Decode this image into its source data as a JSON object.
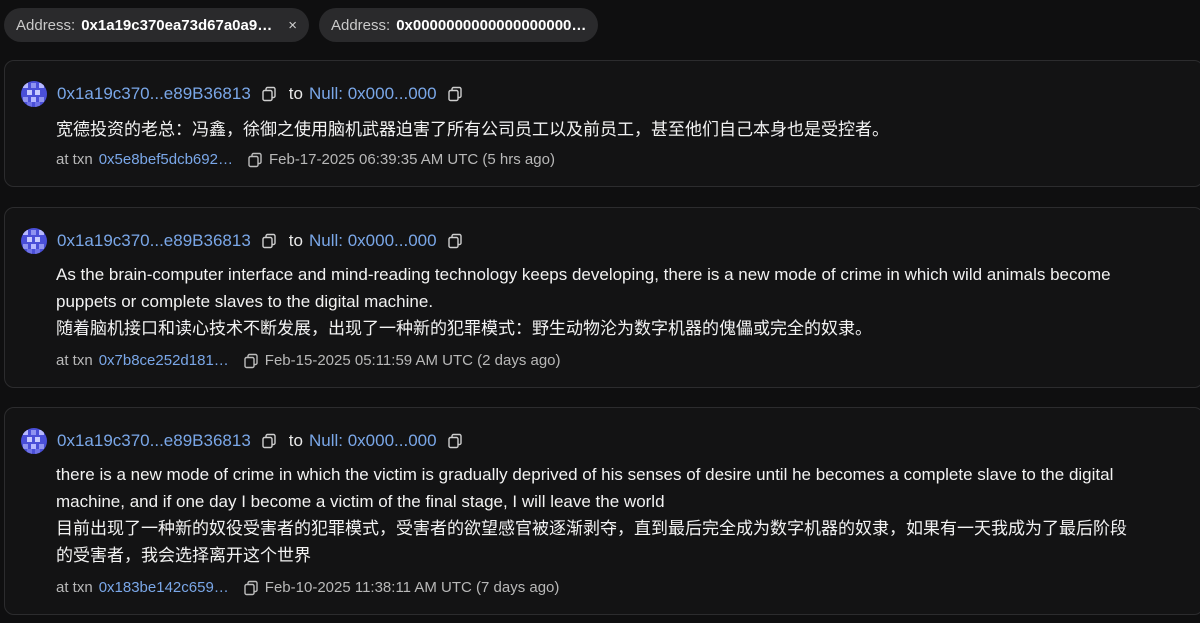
{
  "filters": [
    {
      "label": "Address:",
      "value": "0x1a19c370ea73d67a0a9…"
    },
    {
      "label": "Address:",
      "value": "0x0000000000000000000…"
    }
  ],
  "close_glyph": "×",
  "messages": [
    {
      "from": "0x1a19c370...e89B36813",
      "to_label": "to",
      "to": "Null: 0x000...000",
      "text": "宽德投资的老总：冯鑫，徐御之使用脑机武器迫害了所有公司员工以及前员工，甚至他们自己本身也是受控者。",
      "at_txn": "at txn",
      "txn": "0x5e8bef5dcb692…",
      "date": "Feb-17-2025 06:39:35 AM UTC (5 hrs ago)"
    },
    {
      "from": "0x1a19c370...e89B36813",
      "to_label": "to",
      "to": "Null: 0x000...000",
      "text": "As the brain-computer interface and mind-reading technology keeps developing, there is a new mode of crime in which wild animals become\npuppets or complete slaves to the digital machine.\n随着脑机接口和读心技术不断发展，出现了一种新的犯罪模式：野生动物沦为数字机器的傀儡或完全的奴隶。",
      "at_txn": "at txn",
      "txn": "0x7b8ce252d181…",
      "date": "Feb-15-2025 05:11:59 AM UTC (2 days ago)"
    },
    {
      "from": "0x1a19c370...e89B36813",
      "to_label": "to",
      "to": "Null: 0x000...000",
      "text": "there is a new mode of crime in which the victim is gradually deprived of his senses of desire until he becomes a complete slave to the digital\nmachine, and if one day I become a victim of the final stage, I will leave the world\n目前出现了一种新的奴役受害者的犯罪模式，受害者的欲望感官被逐渐剥夺，直到最后完全成为数字机器的奴隶，如果有一天我成为了最后阶段\n的受害者，我会选择离开这个世界",
      "at_txn": "at txn",
      "txn": "0x183be142c659…",
      "date": "Feb-10-2025 11:38:11 AM UTC (7 days ago)"
    }
  ],
  "colors": {
    "background": "#0f0f10",
    "card": "#131314",
    "link": "#7aa7e8",
    "chip": "#2a2a2c"
  }
}
